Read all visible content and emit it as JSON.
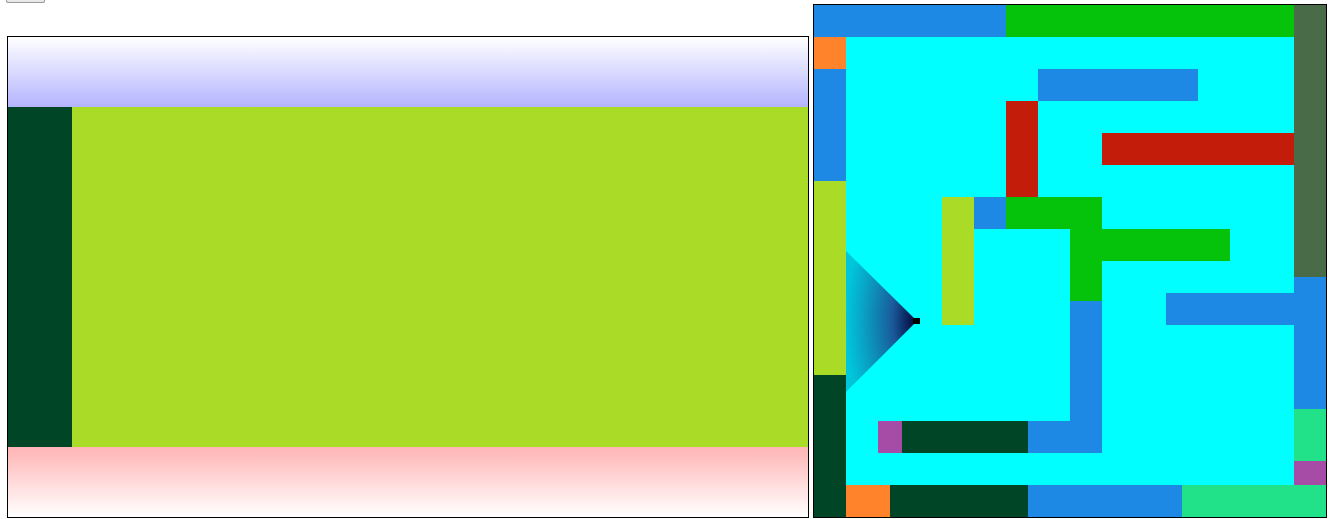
{
  "controls": {
    "top_button_label": ""
  },
  "colors": {
    "sky_top": "#ffffff",
    "sky_bottom": "#b4b4ff",
    "floor_top": "#ffb4b4",
    "floor_bottom": "#ffffff",
    "wall_near": "#aadb26",
    "wall_dark": "#004526",
    "open_floor": "#00ffff",
    "blue": "#1e88e5",
    "green": "#04c30a",
    "red": "#c41c0a",
    "olive": "#4a6b48",
    "orange": "#fe832a",
    "lime": "#aadb26",
    "dark": "#004526",
    "mint": "#21e288",
    "purple": "#a64ba6",
    "player_cone": "#00bcd4",
    "player_marker": "#000000"
  },
  "minimap": {
    "grid_cells": 16
  }
}
